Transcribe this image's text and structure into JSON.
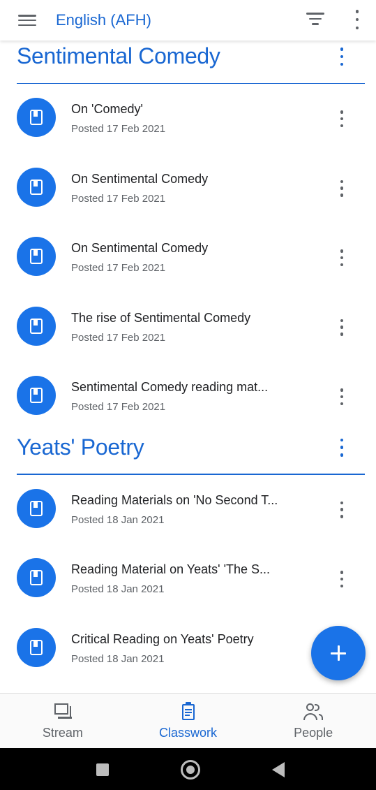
{
  "appbar": {
    "title": "English (AFH)",
    "icons": [
      "menu-icon",
      "filter-icon",
      "more-vert-icon"
    ]
  },
  "topics": [
    {
      "name": "Sentimental Comedy",
      "items": [
        {
          "title": "On 'Comedy'",
          "date": "Posted 17 Feb 2021"
        },
        {
          "title": "On Sentimental Comedy",
          "date": "Posted 17 Feb 2021"
        },
        {
          "title": "On Sentimental Comedy",
          "date": "Posted 17 Feb 2021"
        },
        {
          "title": "The rise of Sentimental Comedy",
          "date": "Posted 17 Feb 2021"
        },
        {
          "title": "Sentimental Comedy reading mat...",
          "date": "Posted 17 Feb 2021"
        }
      ]
    },
    {
      "name": "Yeats' Poetry",
      "items": [
        {
          "title": "Reading Materials on 'No Second T...",
          "date": "Posted 18 Jan 2021"
        },
        {
          "title": "Reading Material on Yeats' 'The  S...",
          "date": "Posted 18 Jan 2021"
        },
        {
          "title": "Critical Reading on Yeats' Poetry",
          "date": "Posted 18 Jan 2021"
        }
      ]
    }
  ],
  "fab": {
    "icon": "plus-icon"
  },
  "bottom_nav": {
    "active": "Classwork",
    "items": [
      {
        "label": "Stream",
        "icon": "stream-icon"
      },
      {
        "label": "Classwork",
        "icon": "classwork-icon"
      },
      {
        "label": "People",
        "icon": "people-icon"
      }
    ]
  },
  "colors": {
    "accent": "#1967d2",
    "fab": "#1a73e8",
    "text_primary": "#202124",
    "text_secondary": "#5f6368"
  }
}
